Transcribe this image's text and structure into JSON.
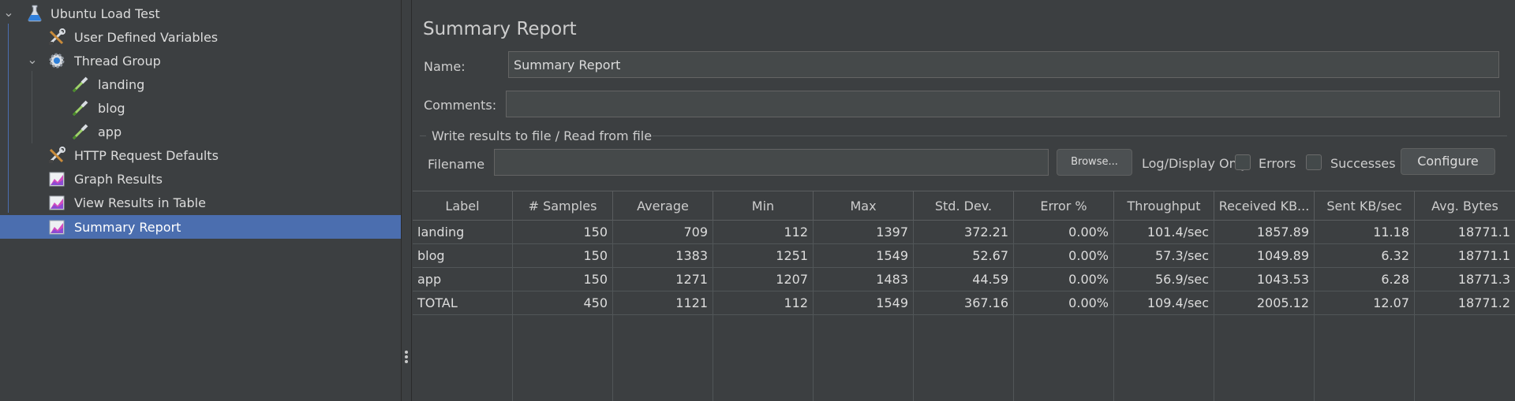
{
  "tree": {
    "items": [
      {
        "label": "Ubuntu Load Test",
        "icon": "flask-icon"
      },
      {
        "label": "User Defined Variables",
        "icon": "tools-icon"
      },
      {
        "label": "Thread Group",
        "icon": "gear-icon"
      },
      {
        "label": "landing",
        "icon": "pipette-icon"
      },
      {
        "label": "blog",
        "icon": "pipette-icon"
      },
      {
        "label": "app",
        "icon": "pipette-icon"
      },
      {
        "label": "HTTP Request Defaults",
        "icon": "tools-icon"
      },
      {
        "label": "Graph Results",
        "icon": "chart-icon"
      },
      {
        "label": "View Results in Table",
        "icon": "chart-icon"
      },
      {
        "label": "Summary Report",
        "icon": "chart-icon",
        "selected": true
      }
    ]
  },
  "panel": {
    "title": "Summary Report",
    "name_label": "Name:",
    "name_value": "Summary Report",
    "comments_label": "Comments:",
    "comments_value": "",
    "file_group_title": "Write results to file / Read from file",
    "filename_label": "Filename",
    "filename_value": "",
    "browse_label": "Browse...",
    "log_display_label": "Log/Display Only:",
    "errors_label": "Errors",
    "errors_checked": false,
    "successes_label": "Successes",
    "successes_checked": false,
    "configure_label": "Configure"
  },
  "table": {
    "headers": [
      "Label",
      "# Samples",
      "Average",
      "Min",
      "Max",
      "Std. Dev.",
      "Error %",
      "Throughput",
      "Received KB...",
      "Sent KB/sec",
      "Avg. Bytes"
    ],
    "rows": [
      [
        "landing",
        "150",
        "709",
        "112",
        "1397",
        "372.21",
        "0.00%",
        "101.4/sec",
        "1857.89",
        "11.18",
        "18771.1"
      ],
      [
        "blog",
        "150",
        "1383",
        "1251",
        "1549",
        "52.67",
        "0.00%",
        "57.3/sec",
        "1049.89",
        "6.32",
        "18771.1"
      ],
      [
        "app",
        "150",
        "1271",
        "1207",
        "1483",
        "44.59",
        "0.00%",
        "56.9/sec",
        "1043.53",
        "6.28",
        "18771.3"
      ],
      [
        "TOTAL",
        "450",
        "1121",
        "112",
        "1549",
        "367.16",
        "0.00%",
        "109.4/sec",
        "2005.12",
        "12.07",
        "18771.2"
      ]
    ]
  },
  "colors": {
    "background": "#3c3f41",
    "selection": "#4b6eaf",
    "text": "#dcdcdc"
  }
}
